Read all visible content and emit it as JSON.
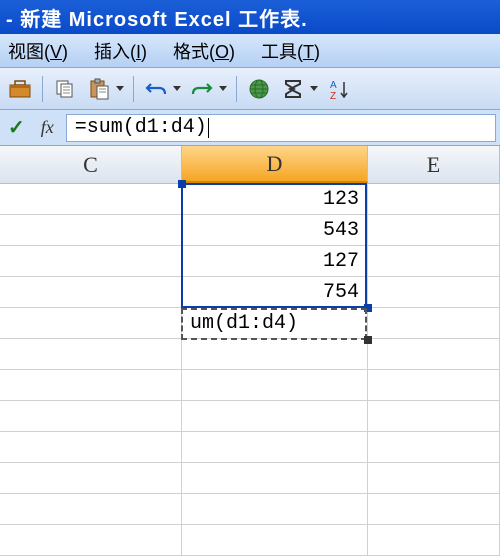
{
  "titlebar": {
    "text": "- 新建 Microsoft Excel 工作表."
  },
  "menubar": {
    "items": [
      {
        "label": "视图",
        "accel": "V"
      },
      {
        "label": "插入",
        "accel": "I"
      },
      {
        "label": "格式",
        "accel": "O"
      },
      {
        "label": "工具",
        "accel": "T"
      }
    ]
  },
  "toolbar": {
    "icons": [
      "toolbox-icon",
      "copy-icon",
      "paste-icon",
      "undo-icon",
      "redo-icon",
      "link-icon",
      "autosum-icon",
      "sort-asc-icon"
    ]
  },
  "formula_bar": {
    "fx_label": "fx",
    "value": "=sum(d1:d4)"
  },
  "columns": {
    "c": "C",
    "d": "D",
    "e": "E"
  },
  "cells": {
    "d1": "123",
    "d2": "543",
    "d3": "127",
    "d4": "754",
    "d5": "um(d1:d4)"
  },
  "chart_data": {
    "type": "table",
    "columns": [
      "C",
      "D",
      "E"
    ],
    "rows": [
      {
        "C": "",
        "D": 123,
        "E": ""
      },
      {
        "C": "",
        "D": 543,
        "E": ""
      },
      {
        "C": "",
        "D": 127,
        "E": ""
      },
      {
        "C": "",
        "D": 754,
        "E": ""
      },
      {
        "C": "",
        "D": "=sum(d1:d4)",
        "E": ""
      }
    ],
    "active_cell": "D5",
    "selected_range": "D1:D4"
  },
  "colors": {
    "titlebar": "#0a4ac9",
    "selection_border": "#0a3ea8",
    "selected_header": "#f5a623"
  }
}
